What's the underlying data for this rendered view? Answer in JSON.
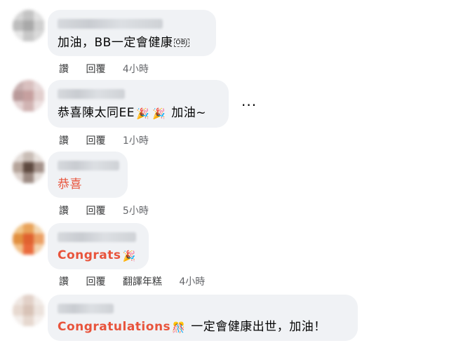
{
  "comments": [
    {
      "text": "加油，BB一定會健康",
      "emoji_suffix": "OBJ",
      "actions": {
        "like": "讚",
        "reply": "回覆",
        "time": "4小時"
      }
    },
    {
      "text_before": "恭喜陳太同EE",
      "emoji1": "🎉",
      "emoji2": "🎉",
      "text_after": " 加油~",
      "actions": {
        "like": "讚",
        "reply": "回覆",
        "time": "1小時"
      }
    },
    {
      "text": "恭喜",
      "actions": {
        "like": "讚",
        "reply": "回覆",
        "time": "5小時"
      }
    },
    {
      "text": "Congrats",
      "emoji": "🎉",
      "actions": {
        "like": "讚",
        "reply": "回覆",
        "translate": "翻譯年糕",
        "time": "4小時"
      }
    },
    {
      "text_before": "Congratulations",
      "emoji": "🎊",
      "text_after": " 一定會健康出世，加油！"
    }
  ],
  "more_menu": "···",
  "icons": {
    "more": "more-options-icon",
    "party": "party-popper-icon",
    "confetti": "confetti-ball-icon"
  },
  "colors": {
    "bubble": "#f0f2f5",
    "highlight_text": "#e8543c",
    "action_text": "#3a3b3c"
  }
}
